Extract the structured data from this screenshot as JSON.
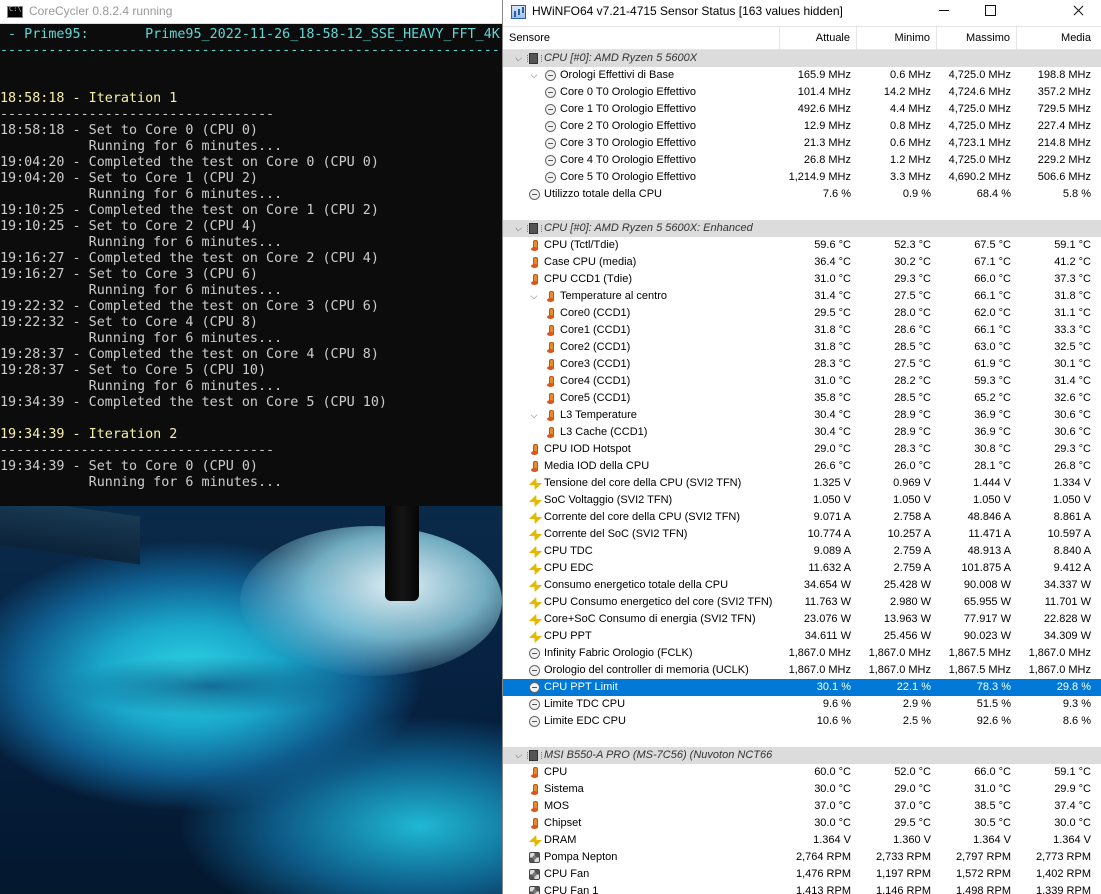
{
  "console": {
    "title": "CoreCycler 0.8.2.4 running",
    "lines": [
      {
        "text": " - Prime95:       Prime95_2022-11-26_18-58-12_SSE_HEAVY_FFT_4K-1",
        "color": "cyan"
      },
      {
        "text": "--------------------------------------------------------------",
        "color": "cyan"
      },
      {
        "text": "",
        "color": "white"
      },
      {
        "text": "",
        "color": "white"
      },
      {
        "text": "18:58:18 - Iteration 1",
        "color": "yellow"
      },
      {
        "text": "----------------------------------",
        "color": "white"
      },
      {
        "text": "18:58:18 - Set to Core 0 (CPU 0)",
        "color": "white"
      },
      {
        "text": "           Running for 6 minutes...",
        "color": "white"
      },
      {
        "text": "19:04:20 - Completed the test on Core 0 (CPU 0)",
        "color": "white"
      },
      {
        "text": "19:04:20 - Set to Core 1 (CPU 2)",
        "color": "white"
      },
      {
        "text": "           Running for 6 minutes...",
        "color": "white"
      },
      {
        "text": "19:10:25 - Completed the test on Core 1 (CPU 2)",
        "color": "white"
      },
      {
        "text": "19:10:25 - Set to Core 2 (CPU 4)",
        "color": "white"
      },
      {
        "text": "           Running for 6 minutes...",
        "color": "white"
      },
      {
        "text": "19:16:27 - Completed the test on Core 2 (CPU 4)",
        "color": "white"
      },
      {
        "text": "19:16:27 - Set to Core 3 (CPU 6)",
        "color": "white"
      },
      {
        "text": "           Running for 6 minutes...",
        "color": "white"
      },
      {
        "text": "19:22:32 - Completed the test on Core 3 (CPU 6)",
        "color": "white"
      },
      {
        "text": "19:22:32 - Set to Core 4 (CPU 8)",
        "color": "white"
      },
      {
        "text": "           Running for 6 minutes...",
        "color": "white"
      },
      {
        "text": "19:28:37 - Completed the test on Core 4 (CPU 8)",
        "color": "white"
      },
      {
        "text": "19:28:37 - Set to Core 5 (CPU 10)",
        "color": "white"
      },
      {
        "text": "           Running for 6 minutes...",
        "color": "white"
      },
      {
        "text": "19:34:39 - Completed the test on Core 5 (CPU 10)",
        "color": "white"
      },
      {
        "text": "",
        "color": "white"
      },
      {
        "text": "19:34:39 - Iteration 2",
        "color": "yellow"
      },
      {
        "text": "----------------------------------",
        "color": "white"
      },
      {
        "text": "19:34:39 - Set to Core 0 (CPU 0)",
        "color": "white"
      },
      {
        "text": "           Running for 6 minutes...",
        "color": "white"
      }
    ]
  },
  "hwinfo": {
    "title": "HWiNFO64 v7.21-4715 Sensor Status [163 values hidden]",
    "columns": {
      "sensor": "Sensore",
      "current": "Attuale",
      "min": "Minimo",
      "max": "Massimo",
      "avg": "Media"
    },
    "rows": [
      {
        "type": "group",
        "icon": "chip-icon",
        "label": "CPU [#0]: AMD Ryzen 5 5600X"
      },
      {
        "type": "parent",
        "icon": "clock-icon",
        "label": "Orologi Effettivi di Base",
        "indent": 2,
        "values": [
          "165.9 MHz",
          "0.6 MHz",
          "4,725.0 MHz",
          "198.8 MHz"
        ]
      },
      {
        "type": "item",
        "icon": "clock-icon",
        "label": "Core 0 T0 Orologio Effettivo",
        "indent": 3,
        "values": [
          "101.4 MHz",
          "14.2 MHz",
          "4,724.6 MHz",
          "357.2 MHz"
        ]
      },
      {
        "type": "item",
        "icon": "clock-icon",
        "label": "Core 1 T0 Orologio Effettivo",
        "indent": 3,
        "values": [
          "492.6 MHz",
          "4.4 MHz",
          "4,725.0 MHz",
          "729.5 MHz"
        ]
      },
      {
        "type": "item",
        "icon": "clock-icon",
        "label": "Core 2 T0 Orologio Effettivo",
        "indent": 3,
        "values": [
          "12.9 MHz",
          "0.8 MHz",
          "4,725.0 MHz",
          "227.4 MHz"
        ]
      },
      {
        "type": "item",
        "icon": "clock-icon",
        "label": "Core 3 T0 Orologio Effettivo",
        "indent": 3,
        "values": [
          "21.3 MHz",
          "0.6 MHz",
          "4,723.1 MHz",
          "214.8 MHz"
        ]
      },
      {
        "type": "item",
        "icon": "clock-icon",
        "label": "Core 4 T0 Orologio Effettivo",
        "indent": 3,
        "values": [
          "26.8 MHz",
          "1.2 MHz",
          "4,725.0 MHz",
          "229.2 MHz"
        ]
      },
      {
        "type": "item",
        "icon": "clock-icon",
        "label": "Core 5 T0 Orologio Effettivo",
        "indent": 3,
        "values": [
          "1,214.9 MHz",
          "3.3 MHz",
          "4,690.2 MHz",
          "506.6 MHz"
        ]
      },
      {
        "type": "item",
        "icon": "clock-icon",
        "label": "Utilizzo totale della CPU",
        "indent": 1,
        "values": [
          "7.6 %",
          "0.9 %",
          "68.4 %",
          "5.8 %"
        ]
      },
      {
        "type": "spacer"
      },
      {
        "type": "group",
        "icon": "chip-icon",
        "label": "CPU [#0]: AMD Ryzen 5 5600X: Enhanced"
      },
      {
        "type": "item",
        "icon": "thermometer-icon",
        "label": "CPU (Tctl/Tdie)",
        "indent": 1,
        "values": [
          "59.6 °C",
          "52.3 °C",
          "67.5 °C",
          "59.1 °C"
        ]
      },
      {
        "type": "item",
        "icon": "thermometer-icon",
        "label": "Case CPU (media)",
        "indent": 1,
        "values": [
          "36.4 °C",
          "30.2 °C",
          "67.1 °C",
          "41.2 °C"
        ]
      },
      {
        "type": "item",
        "icon": "thermometer-icon",
        "label": "CPU CCD1 (Tdie)",
        "indent": 1,
        "values": [
          "31.0 °C",
          "29.3 °C",
          "66.0 °C",
          "37.3 °C"
        ]
      },
      {
        "type": "parent",
        "icon": "thermometer-icon",
        "label": "Temperature al centro",
        "indent": 2,
        "values": [
          "31.4 °C",
          "27.5 °C",
          "66.1 °C",
          "31.8 °C"
        ]
      },
      {
        "type": "item",
        "icon": "thermometer-icon",
        "label": "Core0 (CCD1)",
        "indent": 3,
        "values": [
          "29.5 °C",
          "28.0 °C",
          "62.0 °C",
          "31.1 °C"
        ]
      },
      {
        "type": "item",
        "icon": "thermometer-icon",
        "label": "Core1 (CCD1)",
        "indent": 3,
        "values": [
          "31.8 °C",
          "28.6 °C",
          "66.1 °C",
          "33.3 °C"
        ]
      },
      {
        "type": "item",
        "icon": "thermometer-icon",
        "label": "Core2 (CCD1)",
        "indent": 3,
        "values": [
          "31.8 °C",
          "28.5 °C",
          "63.0 °C",
          "32.5 °C"
        ]
      },
      {
        "type": "item",
        "icon": "thermometer-icon",
        "label": "Core3 (CCD1)",
        "indent": 3,
        "values": [
          "28.3 °C",
          "27.5 °C",
          "61.9 °C",
          "30.1 °C"
        ]
      },
      {
        "type": "item",
        "icon": "thermometer-icon",
        "label": "Core4 (CCD1)",
        "indent": 3,
        "values": [
          "31.0 °C",
          "28.2 °C",
          "59.3 °C",
          "31.4 °C"
        ]
      },
      {
        "type": "item",
        "icon": "thermometer-icon",
        "label": "Core5 (CCD1)",
        "indent": 3,
        "values": [
          "35.8 °C",
          "28.5 °C",
          "65.2 °C",
          "32.6 °C"
        ]
      },
      {
        "type": "parent",
        "icon": "thermometer-icon",
        "label": "L3 Temperature",
        "indent": 2,
        "values": [
          "30.4 °C",
          "28.9 °C",
          "36.9 °C",
          "30.6 °C"
        ]
      },
      {
        "type": "item",
        "icon": "thermometer-icon",
        "label": "L3 Cache (CCD1)",
        "indent": 3,
        "values": [
          "30.4 °C",
          "28.9 °C",
          "36.9 °C",
          "30.6 °C"
        ]
      },
      {
        "type": "item",
        "icon": "thermometer-icon",
        "label": "CPU IOD Hotspot",
        "indent": 1,
        "values": [
          "29.0 °C",
          "28.3 °C",
          "30.8 °C",
          "29.3 °C"
        ]
      },
      {
        "type": "item",
        "icon": "thermometer-icon",
        "label": "Media IOD della CPU",
        "indent": 1,
        "values": [
          "26.6 °C",
          "26.0 °C",
          "28.1 °C",
          "26.8 °C"
        ]
      },
      {
        "type": "item",
        "icon": "bolt-icon",
        "label": "Tensione del core della CPU (SVI2 TFN)",
        "indent": 1,
        "values": [
          "1.325 V",
          "0.969 V",
          "1.444 V",
          "1.334 V"
        ]
      },
      {
        "type": "item",
        "icon": "bolt-icon",
        "label": "SoC Voltaggio (SVI2 TFN)",
        "indent": 1,
        "values": [
          "1.050 V",
          "1.050 V",
          "1.050 V",
          "1.050 V"
        ]
      },
      {
        "type": "item",
        "icon": "bolt-icon",
        "label": "Corrente del core della CPU (SVI2 TFN)",
        "indent": 1,
        "values": [
          "9.071 A",
          "2.758 A",
          "48.846 A",
          "8.861 A"
        ]
      },
      {
        "type": "item",
        "icon": "bolt-icon",
        "label": "Corrente del SoC (SVI2 TFN)",
        "indent": 1,
        "values": [
          "10.774 A",
          "10.257 A",
          "11.471 A",
          "10.597 A"
        ]
      },
      {
        "type": "item",
        "icon": "bolt-icon",
        "label": "CPU TDC",
        "indent": 1,
        "values": [
          "9.089 A",
          "2.759 A",
          "48.913 A",
          "8.840 A"
        ]
      },
      {
        "type": "item",
        "icon": "bolt-icon",
        "label": "CPU EDC",
        "indent": 1,
        "values": [
          "11.632 A",
          "2.759 A",
          "101.875 A",
          "9.412 A"
        ]
      },
      {
        "type": "item",
        "icon": "bolt-icon",
        "label": "Consumo energetico totale della CPU",
        "indent": 1,
        "values": [
          "34.654 W",
          "25.428 W",
          "90.008 W",
          "34.337 W"
        ]
      },
      {
        "type": "item",
        "icon": "bolt-icon",
        "label": "CPU Consumo energetico del core (SVI2 TFN)",
        "indent": 1,
        "values": [
          "11.763 W",
          "2.980 W",
          "65.955 W",
          "11.701 W"
        ]
      },
      {
        "type": "item",
        "icon": "bolt-icon",
        "label": "Core+SoC Consumo di energia (SVI2 TFN)",
        "indent": 1,
        "values": [
          "23.076 W",
          "13.963 W",
          "77.917 W",
          "22.828 W"
        ]
      },
      {
        "type": "item",
        "icon": "bolt-icon",
        "label": "CPU PPT",
        "indent": 1,
        "values": [
          "34.611 W",
          "25.456 W",
          "90.023 W",
          "34.309 W"
        ]
      },
      {
        "type": "item",
        "icon": "clock-icon",
        "label": "Infinity Fabric Orologio (FCLK)",
        "indent": 1,
        "values": [
          "1,867.0 MHz",
          "1,867.0 MHz",
          "1,867.5 MHz",
          "1,867.0 MHz"
        ]
      },
      {
        "type": "item",
        "icon": "clock-icon",
        "label": "Orologio del controller di memoria (UCLK)",
        "indent": 1,
        "values": [
          "1,867.0 MHz",
          "1,867.0 MHz",
          "1,867.5 MHz",
          "1,867.0 MHz"
        ]
      },
      {
        "type": "item",
        "icon": "clock-icon",
        "label": "CPU PPT Limit",
        "indent": 1,
        "selected": true,
        "values": [
          "30.1 %",
          "22.1 %",
          "78.3 %",
          "29.8 %"
        ]
      },
      {
        "type": "item",
        "icon": "clock-icon",
        "label": "Limite TDC CPU",
        "indent": 1,
        "values": [
          "9.6 %",
          "2.9 %",
          "51.5 %",
          "9.3 %"
        ]
      },
      {
        "type": "item",
        "icon": "clock-icon",
        "label": "Limite EDC CPU",
        "indent": 1,
        "values": [
          "10.6 %",
          "2.5 %",
          "92.6 %",
          "8.6 %"
        ]
      },
      {
        "type": "spacer"
      },
      {
        "type": "group",
        "icon": "chip-icon",
        "label": "MSI B550-A PRO (MS-7C56) (Nuvoton NCT66..."
      },
      {
        "type": "item",
        "icon": "thermometer-icon",
        "label": "CPU",
        "indent": 1,
        "values": [
          "60.0 °C",
          "52.0 °C",
          "66.0 °C",
          "59.1 °C"
        ]
      },
      {
        "type": "item",
        "icon": "thermometer-icon",
        "label": "Sistema",
        "indent": 1,
        "values": [
          "30.0 °C",
          "29.0 °C",
          "31.0 °C",
          "29.9 °C"
        ]
      },
      {
        "type": "item",
        "icon": "thermometer-icon",
        "label": "MOS",
        "indent": 1,
        "values": [
          "37.0 °C",
          "37.0 °C",
          "38.5 °C",
          "37.4 °C"
        ]
      },
      {
        "type": "item",
        "icon": "thermometer-icon",
        "label": "Chipset",
        "indent": 1,
        "values": [
          "30.0 °C",
          "29.5 °C",
          "30.5 °C",
          "30.0 °C"
        ]
      },
      {
        "type": "item",
        "icon": "bolt-icon",
        "label": "DRAM",
        "indent": 1,
        "values": [
          "1.364 V",
          "1.360 V",
          "1.364 V",
          "1.364 V"
        ]
      },
      {
        "type": "item",
        "icon": "fan-icon",
        "label": "Pompa Nepton",
        "indent": 1,
        "values": [
          "2,764 RPM",
          "2,733 RPM",
          "2,797 RPM",
          "2,773 RPM"
        ]
      },
      {
        "type": "item",
        "icon": "fan-icon",
        "label": "CPU Fan",
        "indent": 1,
        "values": [
          "1,476 RPM",
          "1,197 RPM",
          "1,572 RPM",
          "1,402 RPM"
        ]
      },
      {
        "type": "item",
        "icon": "fan-icon",
        "label": "CPU Fan 1",
        "indent": 1,
        "values": [
          "1,413 RPM",
          "1,146 RPM",
          "1,498 RPM",
          "1,339 RPM"
        ]
      }
    ]
  }
}
